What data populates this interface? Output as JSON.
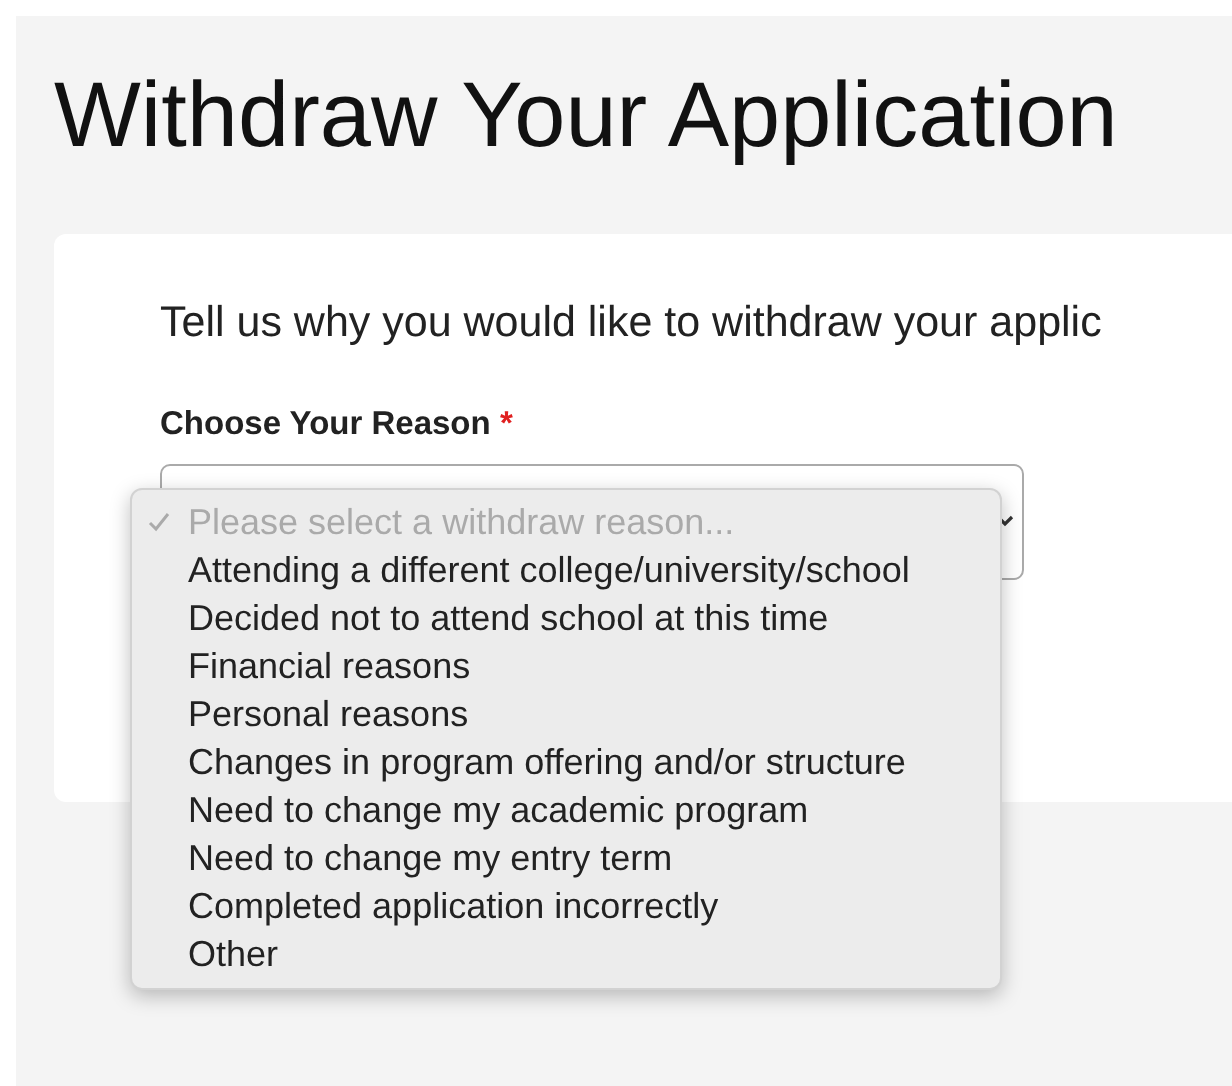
{
  "title": "Withdraw Your Application",
  "card": {
    "intro": "Tell us why you would like to withdraw your applic",
    "field": {
      "label": "Choose Your Reason",
      "required_mark": "*",
      "options": [
        {
          "label": "Please select a withdraw reason...",
          "selected": true,
          "disabled": true
        },
        {
          "label": "Attending a different college/university/school",
          "selected": false,
          "disabled": false
        },
        {
          "label": "Decided not to attend school at this time",
          "selected": false,
          "disabled": false
        },
        {
          "label": "Financial reasons",
          "selected": false,
          "disabled": false
        },
        {
          "label": "Personal reasons",
          "selected": false,
          "disabled": false
        },
        {
          "label": "Changes in program offering and/or structure",
          "selected": false,
          "disabled": false
        },
        {
          "label": "Need to change my academic program",
          "selected": false,
          "disabled": false
        },
        {
          "label": "Need to change my entry term",
          "selected": false,
          "disabled": false
        },
        {
          "label": "Completed application incorrectly",
          "selected": false,
          "disabled": false
        },
        {
          "label": "Other",
          "selected": false,
          "disabled": false
        }
      ]
    }
  }
}
